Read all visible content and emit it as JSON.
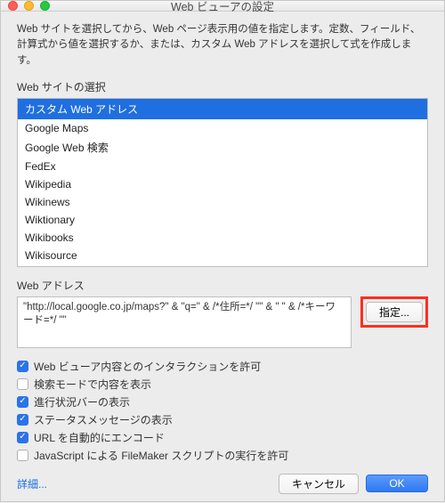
{
  "window": {
    "title": "Web ビューアの設定"
  },
  "description": "Web サイトを選択してから、Web ページ表示用の値を指定します。定数、フィールド、計算式から値を選択するか、または、カスタム Web アドレスを選択して式を作成します。",
  "site_section_label": "Web サイトの選択",
  "sites": {
    "items": [
      "カスタム Web アドレス",
      "Google Maps",
      "Google Web 検索",
      "FedEx",
      "Wikipedia",
      "Wikinews",
      "Wiktionary",
      "Wikibooks",
      "Wikisource"
    ],
    "selected_index": 0
  },
  "address_section_label": "Web アドレス",
  "address_value": "\"http://local.google.co.jp/maps?\" & \"q=\" & /*住所=*/ \"\" & \" \" & /*キーワード=*/ \"\"",
  "specify_button": "指定...",
  "checkboxes": [
    {
      "label": "Web ビューア内容とのインタラクションを許可",
      "checked": true
    },
    {
      "label": "検索モードで内容を表示",
      "checked": false
    },
    {
      "label": "進行状況バーの表示",
      "checked": true
    },
    {
      "label": "ステータスメッセージの表示",
      "checked": true
    },
    {
      "label": "URL を自動的にエンコード",
      "checked": true
    },
    {
      "label": "JavaScript による FileMaker スクリプトの実行を許可",
      "checked": false
    }
  ],
  "details_link": "詳細...",
  "buttons": {
    "cancel": "キャンセル",
    "ok": "OK"
  }
}
